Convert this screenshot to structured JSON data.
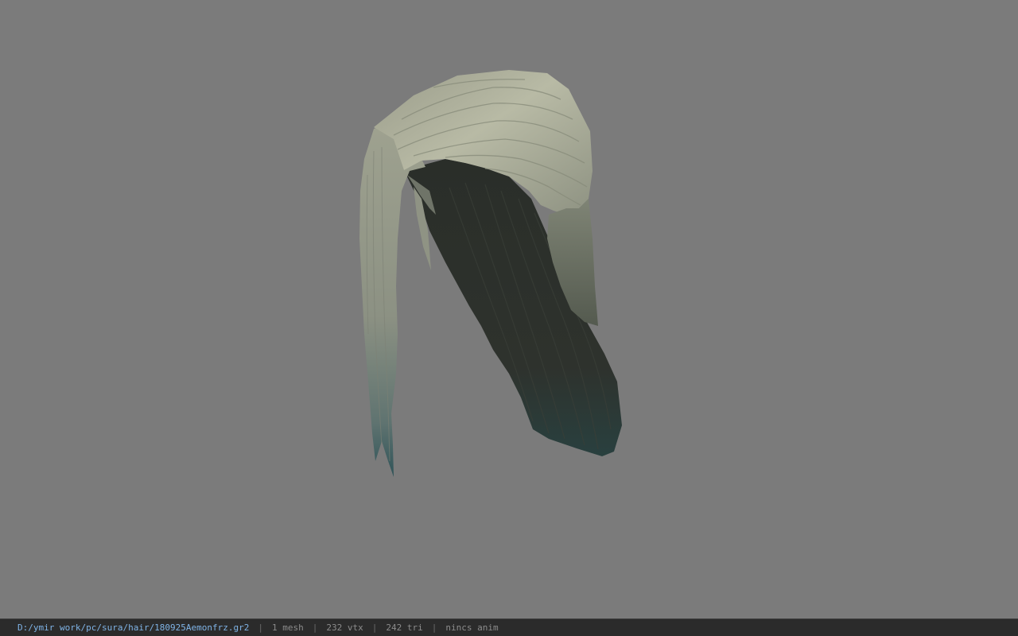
{
  "viewer": {
    "background_color": "#7b7b7b"
  },
  "model": {
    "subject": "hair-mesh",
    "colors": {
      "highlight": "#b9bba6",
      "mid": "#8f9384",
      "shadow": "#3b3f38",
      "dark": "#262a25",
      "tip_tint": "#2c4a4e"
    }
  },
  "status_bar": {
    "file_path": "D:/ymir work/pc/sura/hair/180925Aemonfrz.gr2",
    "separator": "|",
    "mesh_count": "1 mesh",
    "vertex_count": "232 vtx",
    "triangle_count": "242 tri",
    "anim_info": "nincs anim"
  }
}
